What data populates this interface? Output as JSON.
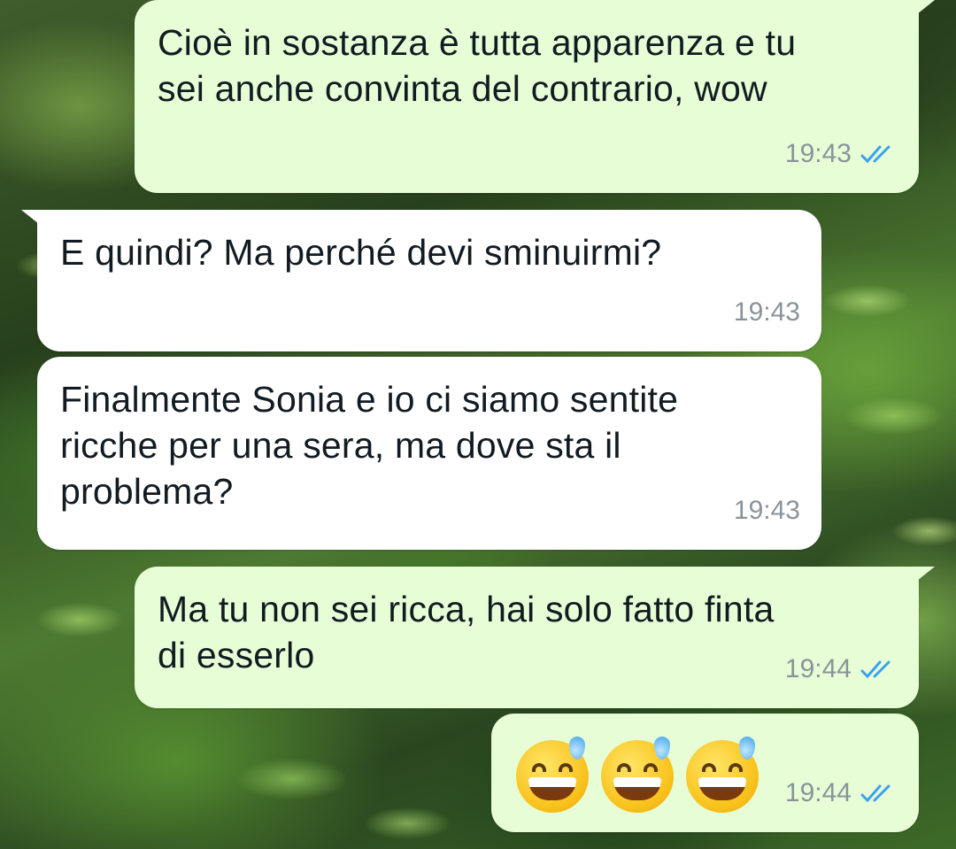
{
  "chat": {
    "messages": [
      {
        "direction": "out",
        "lines": [
          "Cioè in sostanza è tutta apparenza e tu",
          "sei anche convinta del contrario, wow"
        ],
        "time": "19:43",
        "status": "read"
      },
      {
        "direction": "in",
        "lines": [
          "E quindi? Ma perché devi sminuirmi?"
        ],
        "time": "19:43"
      },
      {
        "direction": "in",
        "lines": [
          "Finalmente Sonia e io ci siamo sentite",
          "ricche per una sera, ma dove sta il",
          "problema?"
        ],
        "time": "19:43"
      },
      {
        "direction": "out",
        "lines": [
          "Ma tu non sei ricca, hai solo fatto finta",
          "di esserlo"
        ],
        "time": "19:44",
        "status": "read"
      },
      {
        "direction": "out",
        "emoji": [
          "grinning-face-with-sweat-icon",
          "grinning-face-with-sweat-icon",
          "grinning-face-with-sweat-icon"
        ],
        "time": "19:44",
        "status": "read"
      }
    ]
  },
  "colors": {
    "outgoing_bubble": "#e7fdd6",
    "incoming_bubble": "#ffffff",
    "read_ticks": "#3aa2f0",
    "timestamp": "#8a9399"
  }
}
